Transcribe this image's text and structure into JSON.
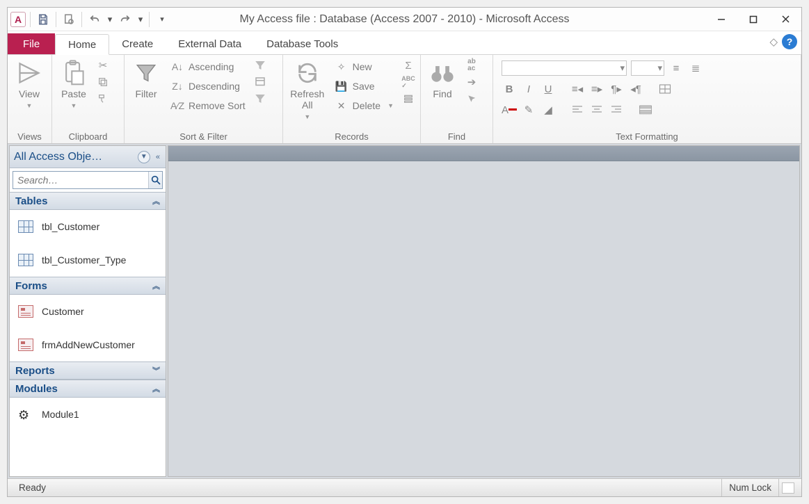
{
  "title": "My Access file : Database (Access 2007 - 2010) - Microsoft Access",
  "tabs": {
    "file": "File",
    "home": "Home",
    "create": "Create",
    "external": "External Data",
    "dbtools": "Database Tools"
  },
  "ribbon": {
    "views": {
      "view": "View",
      "label": "Views"
    },
    "clipboard": {
      "paste": "Paste",
      "label": "Clipboard"
    },
    "sort": {
      "filter": "Filter",
      "asc": "Ascending",
      "desc": "Descending",
      "remove": "Remove Sort",
      "label": "Sort & Filter"
    },
    "records": {
      "refresh": "Refresh\nAll",
      "new": "New",
      "save": "Save",
      "delete": "Delete",
      "label": "Records"
    },
    "find": {
      "find": "Find",
      "label": "Find"
    },
    "textfmt": {
      "label": "Text Formatting"
    }
  },
  "nav": {
    "title": "All Access Obje…",
    "search_placeholder": "Search…",
    "cats": {
      "tables": "Tables",
      "forms": "Forms",
      "reports": "Reports",
      "modules": "Modules"
    },
    "tables": [
      "tbl_Customer",
      "tbl_Customer_Type"
    ],
    "forms": [
      "Customer",
      "frmAddNewCustomer"
    ],
    "modules": [
      "Module1"
    ]
  },
  "status": {
    "ready": "Ready",
    "numlock": "Num Lock"
  }
}
